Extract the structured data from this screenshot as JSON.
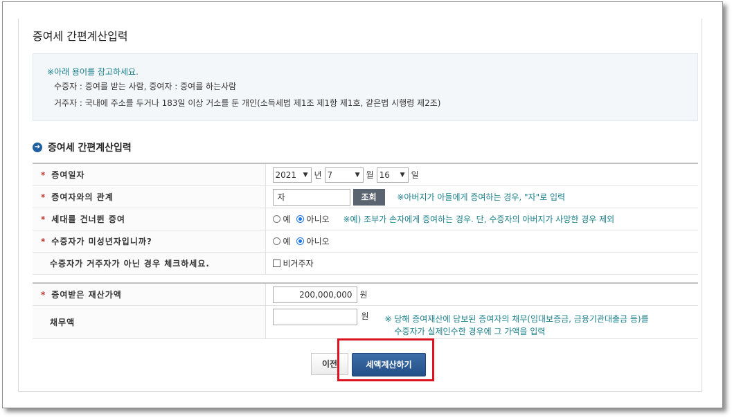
{
  "page": {
    "title": "증여세 간편계산입력"
  },
  "info": {
    "note": "아래 용어를 참고하세요.",
    "line1": "수증자 : 증여를 받는 사람, 증여자 : 증여를 하는사람",
    "line2": "거주자 : 국내에 주소를 두거나 183일 이상 거소를 둔 개인(소득세법 제1조 제1항 제1호, 같은법 시행령 제2조)"
  },
  "section": {
    "title": "증여세 간편계산입력"
  },
  "form": {
    "required_mark": "*",
    "gift_date": {
      "label": "증여일자",
      "year": "2021",
      "year_unit": "년",
      "month": "7",
      "month_unit": "월",
      "day": "16",
      "day_unit": "일"
    },
    "relation": {
      "label": "증여자와의 관계",
      "value": "자",
      "search_label": "조회",
      "hint": "※아버지가 아들에게 증여하는 경우, \"자\"로 입력"
    },
    "generation_skip": {
      "label": "세대를 건너뛴 증여",
      "yes": "예",
      "no": "아니오",
      "selected": "no",
      "hint": "※예) 조부가 손자에게 증여하는 경우. 단, 수증자의 아버지가 사망한 경우 제외"
    },
    "minor": {
      "label": "수증자가 미성년자입니까?",
      "yes": "예",
      "no": "아니오",
      "selected": "no"
    },
    "nonresident": {
      "label": "수증자가 거주자가 아닌 경우 체크하세요.",
      "checkbox_label": "비거주자",
      "checked": false
    },
    "property_value": {
      "label": "증여받은 재산가액",
      "value": "200,000,000",
      "unit": "원"
    },
    "debt": {
      "label": "채무액",
      "value": "",
      "unit": "원",
      "hint_line1": "※ 당해 증여재산에 담보된 증여자의 채무(임대보증금, 금융기관대출금 등)를",
      "hint_line2": "수증자가 실제인수한 경우에 그 가액을 입력"
    }
  },
  "buttons": {
    "prev": "이전",
    "calculate": "세액계산하기"
  },
  "colors": {
    "primary_button": "#234f86",
    "highlight": "#e0121f",
    "hint_text": "#1a7f8a"
  }
}
